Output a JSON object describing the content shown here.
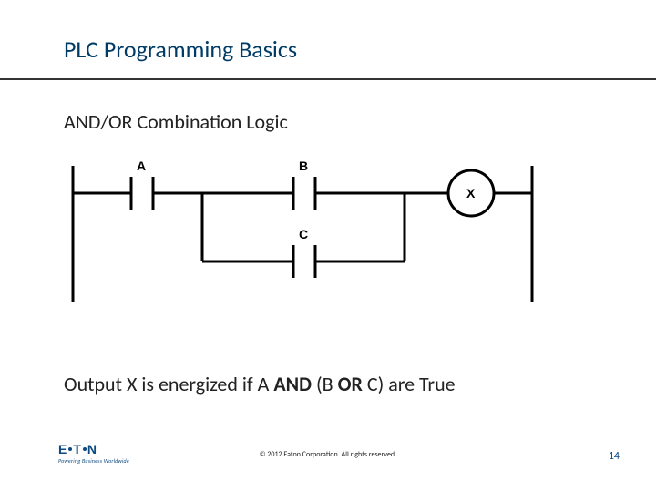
{
  "title": "PLC Programming Basics",
  "subtitle": "AND/OR Combination Logic",
  "diagram": {
    "contacts": {
      "A": "A",
      "B": "B",
      "C": "C"
    },
    "coil": "X"
  },
  "conclusion": {
    "pre": "Output X is energized if A ",
    "and": "AND",
    "mid": " (B ",
    "or": "OR",
    "post": " C) are True"
  },
  "logo": {
    "brand_pre": "E",
    "brand_mid": "T",
    "brand_post": "N",
    "tagline": "Powering Business Worldwide"
  },
  "copyright": "© 2012 Eaton Corporation. All rights reserved.",
  "page_no": "14"
}
